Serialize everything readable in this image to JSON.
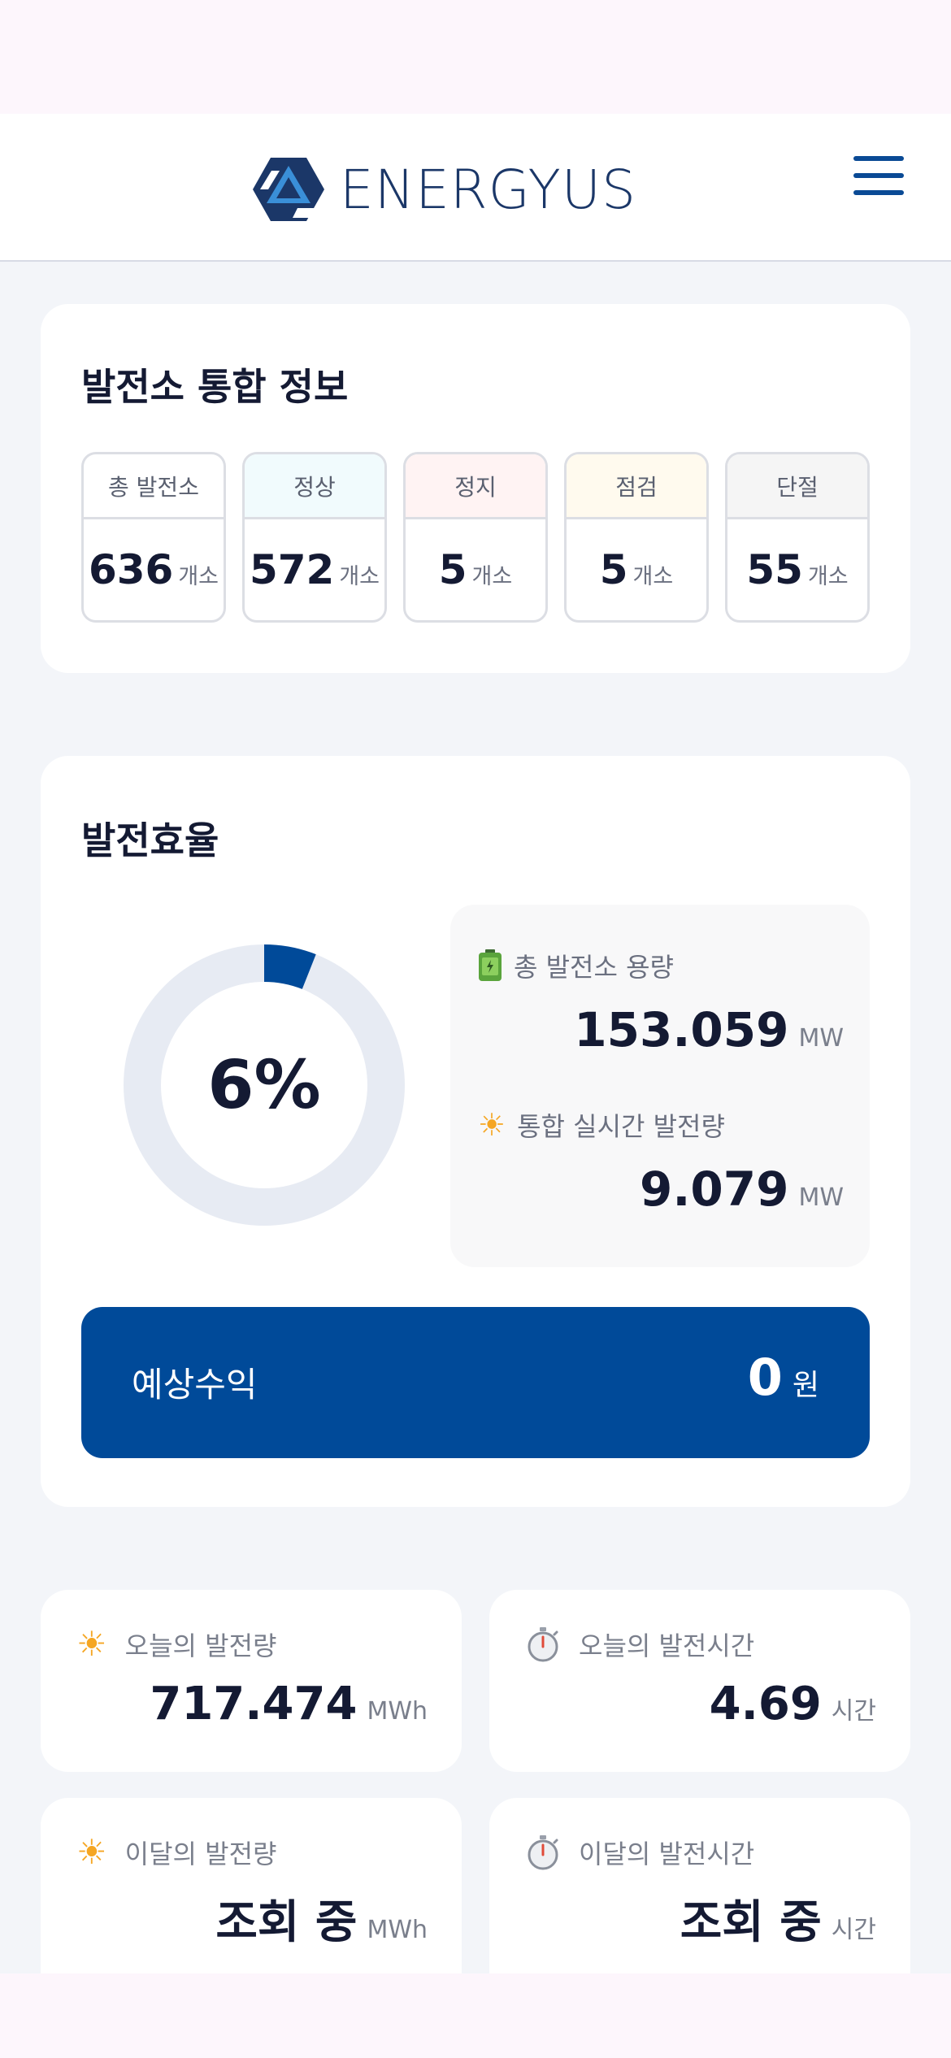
{
  "app": {
    "brand": "ENERGYUS"
  },
  "header": {
    "menu_icon": "hamburger-menu-icon"
  },
  "summary": {
    "title": "발전소 통합 정보",
    "stats": [
      {
        "label": "총 발전소",
        "value": "636",
        "unit": "개소",
        "head_color": "#ffffff"
      },
      {
        "label": "정상",
        "value": "572",
        "unit": "개소",
        "head_color": "#f1fbfd"
      },
      {
        "label": "정지",
        "value": "5",
        "unit": "개소",
        "head_color": "#fff3f3"
      },
      {
        "label": "점검",
        "value": "5",
        "unit": "개소",
        "head_color": "#fffaee"
      },
      {
        "label": "단절",
        "value": "55",
        "unit": "개소",
        "head_color": "#f5f5f5"
      }
    ]
  },
  "efficiency": {
    "title": "발전효율",
    "percent_label": "6%",
    "percent": 6,
    "capacity": {
      "label": "총 발전소 용량",
      "icon": "battery-icon",
      "value": "153.059",
      "unit": "MW"
    },
    "realtime": {
      "label": "통합 실시간 발전량",
      "icon": "sun-icon",
      "value": "9.079",
      "unit": "MW"
    },
    "revenue": {
      "label": "예상수익",
      "value": "0",
      "unit": "원"
    }
  },
  "metrics": [
    {
      "label": "오늘의 발전량",
      "icon": "sun-icon",
      "value": "717.474",
      "unit": "MWh"
    },
    {
      "label": "오늘의 발전시간",
      "icon": "stopwatch-icon",
      "value": "4.69",
      "unit": "시간"
    },
    {
      "label": "이달의 발전량",
      "icon": "sun-icon",
      "value": "조회 중",
      "unit": "MWh"
    },
    {
      "label": "이달의 발전시간",
      "icon": "stopwatch-icon",
      "value": "조회 중",
      "unit": "시간"
    }
  ],
  "colors": {
    "primary": "#004a99",
    "donut_track": "#e7ebf3",
    "text_dark": "#141a33",
    "sun": "#f5a623"
  }
}
